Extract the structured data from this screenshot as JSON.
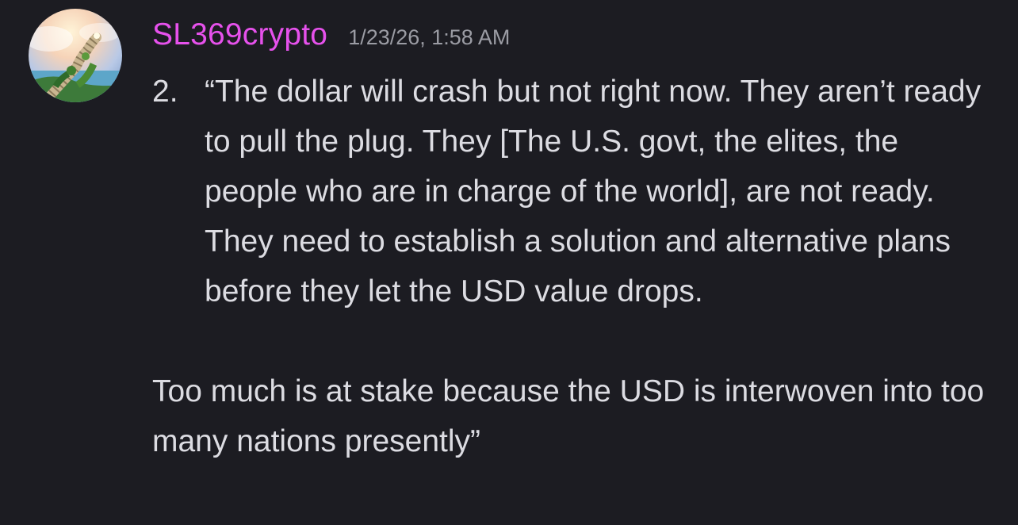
{
  "message": {
    "author": "SL369crypto",
    "timestamp": "1/23/26, 1:58 AM",
    "author_color": "#e651ec",
    "avatar_icon": "stairway-to-heaven-avatar",
    "list_marker": "2.",
    "list_text": "“The dollar will crash but not right now. They aren’t ready to pull the plug. They [The U.S. govt, the elites, the people who are in charge of the world], are not ready. They need to establish a solution and alternative plans before they let the USD value drops.",
    "paragraph": "Too much is at stake because the USD is interwoven into too many nations presently”"
  },
  "colors": {
    "background": "#1c1c22",
    "text": "#dcdce2",
    "timestamp": "#9b9ca4"
  }
}
